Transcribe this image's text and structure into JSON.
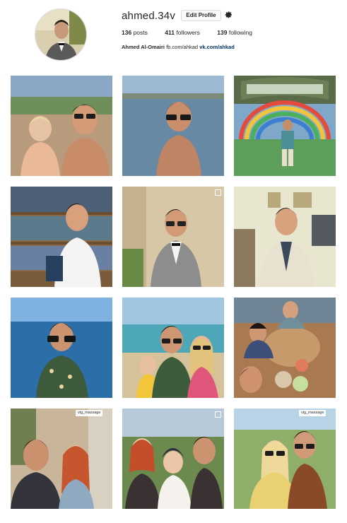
{
  "profile": {
    "username": "ahmed.34v",
    "edit_label": "Edit Profile",
    "settings_icon": "gear-icon",
    "stats": {
      "posts_count": "136",
      "posts_label": "posts",
      "followers_count": "411",
      "followers_label": "followers",
      "following_count": "139",
      "following_label": "following"
    },
    "bio": {
      "full_name": "Ahmed Al-Omairi",
      "link_fb": "fb.com/ahkad",
      "link_vk": "vk.com/ahkad"
    }
  },
  "posts": [
    {
      "id": "post-1",
      "scene": "beach-selfie-with-child",
      "multi": false,
      "repost": ""
    },
    {
      "id": "post-2",
      "scene": "lake-selfie",
      "multi": false,
      "repost": ""
    },
    {
      "id": "post-3",
      "scene": "fairy-tale-museum-entrance",
      "multi": false,
      "repost": ""
    },
    {
      "id": "post-4",
      "scene": "bookshelf-with-passport",
      "multi": false,
      "repost": ""
    },
    {
      "id": "post-5",
      "scene": "tower-suit",
      "multi": true,
      "repost": ""
    },
    {
      "id": "post-6",
      "scene": "living-room-selfie",
      "multi": false,
      "repost": ""
    },
    {
      "id": "post-7",
      "scene": "sea-selfie",
      "multi": false,
      "repost": ""
    },
    {
      "id": "post-8",
      "scene": "beach-group-selfie",
      "multi": false,
      "repost": ""
    },
    {
      "id": "post-9",
      "scene": "dinner-table-friends",
      "multi": false,
      "repost": ""
    },
    {
      "id": "post-10",
      "scene": "couple-selfie",
      "multi": false,
      "repost": "vig_massage"
    },
    {
      "id": "post-11",
      "scene": "family-selfie",
      "multi": true,
      "repost": ""
    },
    {
      "id": "post-12",
      "scene": "park-couple-selfie",
      "multi": false,
      "repost": "vig_massage"
    }
  ]
}
